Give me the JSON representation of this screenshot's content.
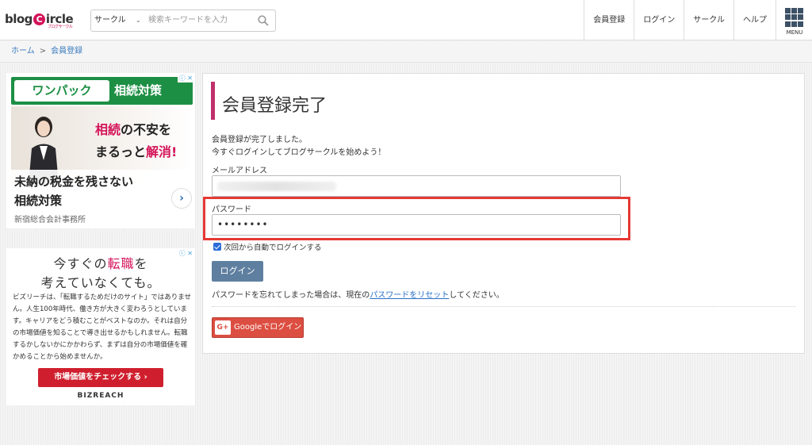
{
  "header": {
    "logo_text": "blogCircle",
    "logo_sub": "ブログサークル",
    "search": {
      "category": "サークル",
      "placeholder": "検索キーワードを入力"
    },
    "nav": [
      "会員登録",
      "ログイン",
      "サークル",
      "ヘルプ"
    ],
    "menu_label": "MENU"
  },
  "breadcrumb": {
    "home": "ホーム",
    "separator": ">",
    "current": "会員登録"
  },
  "ads": {
    "ad1": {
      "banner_white": "ワンパック",
      "banner_green": "相続対策",
      "headline1_a": "相続",
      "headline1_b": "の不安を",
      "headline2_a": "まるっと",
      "headline2_b": "解消!",
      "text1": "未納の税金を残さない",
      "text2": "相続対策",
      "source": "新宿総合会計事務所",
      "choice": "ⓘ ✕"
    },
    "ad2": {
      "h1_a": "今すぐの",
      "h1_b": "転職",
      "h1_c": "を",
      "h2": "考えていなくても。",
      "body": "ビズリーチは、「転職するためだけのサイト」ではありません。人生100年時代、働き方が大きく変わろうとしています。キャリアをどう積むことがベストなのか。それは自分の市場価値を知ることで導き出せるかもしれません。転職するかしないかにかかわらず、まずは自分の市場価値を確かめることから始めませんか。",
      "button": "市場価値をチェックする ›",
      "brand": "BIZREACH",
      "choice": "ⓘ ✕"
    }
  },
  "main": {
    "title": "会員登録完了",
    "message1": "会員登録が完了しました。",
    "message2": "今すぐログインしてブログサークルを始めよう！",
    "email_label": "メールアドレス",
    "email_value": "",
    "password_label": "パスワード",
    "password_value": "••••••••",
    "remember_label": "次回から自動でログインする",
    "remember_checked": true,
    "login_button": "ログイン",
    "forgot_prefix": "パスワードを忘れてしまった場合は、現在の",
    "forgot_link": "パスワードをリセット",
    "forgot_suffix": "してください。",
    "google_icon": "G+",
    "google_button": "Googleでログイン"
  },
  "colors": {
    "accent": "#c0306b",
    "highlight": "#e53935",
    "login_button": "#5f7fa0",
    "google": "#dc4e41",
    "link": "#2a6fc9"
  }
}
